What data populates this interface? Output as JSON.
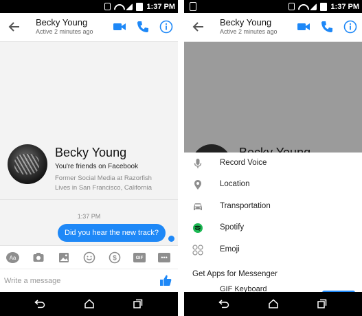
{
  "status_bar": {
    "time": "1:37 PM"
  },
  "chat": {
    "contact_name": "Becky Young",
    "active_status": "Active 2 minutes ago"
  },
  "profile": {
    "name": "Becky Young",
    "friends_text": "You're friends on Facebook",
    "line1": "Former Social Media at Razorfish",
    "line2": "Lives in San Francisco, California"
  },
  "conversation": {
    "timestamp": "1:37 PM",
    "message": "Did you hear the new track?"
  },
  "toolbar": {
    "aa_label": "Aa",
    "gif_label": "GIF",
    "more_label": "•••"
  },
  "composer": {
    "placeholder": "Write a message"
  },
  "sheet": {
    "items": [
      {
        "label": "Record Voice",
        "icon": "microphone-icon"
      },
      {
        "label": "Location",
        "icon": "location-pin-icon"
      },
      {
        "label": "Transportation",
        "icon": "car-icon"
      },
      {
        "label": "Spotify",
        "icon": "spotify-icon"
      },
      {
        "label": "Emoji",
        "icon": "emoji-grid-icon"
      }
    ],
    "section_title": "Get Apps for Messenger",
    "peek_item": "GIF Keyboard"
  },
  "colors": {
    "accent": "#1e88f7",
    "spotify": "#1db954",
    "dim_overlay": "#9b9b9b"
  }
}
